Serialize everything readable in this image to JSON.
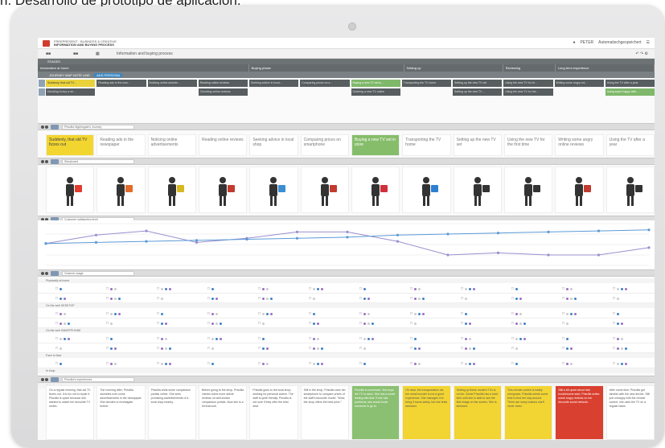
{
  "caption": "n. Desarrollo de prototipo de aplicación.",
  "app": {
    "brand_small": "FREEPRESENT · BUSINESS & CREATIVE",
    "title": "INFORMATION AND BUYING PROCESS",
    "subtitle": "Information and buying process",
    "user": "PETER",
    "project": "Automatischgespeichert"
  },
  "stages_label": "STAGES",
  "phases": [
    "Information at home",
    "Buying phase",
    "Setting up",
    "Reviewing",
    "Long term experience"
  ],
  "persona_label": "JOURNEY MAP NOTE LINE",
  "persona_badge": "ADD PERSONA",
  "steps_row1": [
    {
      "t": "Suddenly, that old TV...",
      "c": "y"
    },
    {
      "t": "Reading ads in the new...",
      "c": ""
    },
    {
      "t": "Noticing online adverts...",
      "c": ""
    },
    {
      "t": "Reading online reviews",
      "c": ""
    },
    {
      "t": "Seeking advice in local...",
      "c": ""
    },
    {
      "t": "Comparing prices on s...",
      "c": ""
    },
    {
      "t": "Buying a new TV set in...",
      "c": "g"
    },
    {
      "t": "Transporting the TV home",
      "c": ""
    },
    {
      "t": "Setting up the new TV set",
      "c": ""
    },
    {
      "t": "Using the new TV for th...",
      "c": ""
    },
    {
      "t": "Writing some angry onl...",
      "c": ""
    },
    {
      "t": "Using the TV after a year",
      "c": ""
    }
  ],
  "steps_row2": [
    {
      "t": "Deciding to buy a ne...",
      "c": ""
    },
    {
      "t": "",
      "c": "e"
    },
    {
      "t": "",
      "c": "e"
    },
    {
      "t": "Checking online reviews",
      "c": ""
    },
    {
      "t": "",
      "c": "e"
    },
    {
      "t": "",
      "c": "e"
    },
    {
      "t": "Ordering a new TV online",
      "c": ""
    },
    {
      "t": "",
      "c": "e"
    },
    {
      "t": "Setting up the new TV ...",
      "c": ""
    },
    {
      "t": "Using the new TV for the...",
      "c": ""
    },
    {
      "t": "",
      "c": "e"
    },
    {
      "t": "Using super happy with...",
      "c": "g"
    }
  ],
  "journey_section": "Priscilla Nightingale's Journey",
  "journey": [
    {
      "t": "Suddenly, that old TV fizzes out",
      "c": "y"
    },
    {
      "t": "Reading ads in the newspaper",
      "c": ""
    },
    {
      "t": "Noticing online advertisements",
      "c": ""
    },
    {
      "t": "Reading online reviews",
      "c": ""
    },
    {
      "t": "Seeking advice in local shop",
      "c": ""
    },
    {
      "t": "Comparing prices on smartphone",
      "c": ""
    },
    {
      "t": "Buying a new TV set in store",
      "c": "g"
    },
    {
      "t": "Transporting the TV home",
      "c": ""
    },
    {
      "t": "Setting up the new TV set",
      "c": ""
    },
    {
      "t": "Using the new TV for the first time",
      "c": ""
    },
    {
      "t": "Writing some angry online reviews",
      "c": ""
    },
    {
      "t": "Using the TV after a year",
      "c": ""
    }
  ],
  "storyboard_section": "Storyboard",
  "storyboard_props": [
    "#e23b2f",
    "#e06b2a",
    "#d8b820",
    "#c23b2f",
    "#3b8fd0",
    "#c23b2f",
    "#d0303a",
    "#2d7fd2",
    "#333333",
    "#333333",
    "#c23b2f",
    "#333333"
  ],
  "satisfaction_section": "Customer satisfaction level",
  "chart_data": {
    "type": "line",
    "title": "",
    "series": [
      {
        "values": [
          3.1,
          3.9,
          4.3,
          3.2,
          3.6,
          4.2,
          4.2,
          3.3,
          2.0,
          2.2,
          2.0,
          2.0,
          2.7
        ]
      },
      {
        "values": [
          3.1,
          3.2,
          3.3,
          3.4,
          3.5,
          3.6,
          3.7,
          3.9,
          4.0,
          4.1,
          4.2,
          4.3,
          4.4
        ]
      }
    ],
    "ylim": [
      1,
      5
    ],
    "colors": [
      "#9a8fcf",
      "#5b9ad6"
    ]
  },
  "channel_section": "Channel usage",
  "channel_groups": [
    "Physically at home",
    "On the web DESKTOP",
    "On the web SMARTPHONE",
    "Face to face",
    "In shop"
  ],
  "add_channel": "Add channel",
  "experience_section": "Priscilla's experiences",
  "experiences": [
    {
      "t": "On a regular evening, that old TV fizzes out. It is too old to repair it. Priscilla is upset because she wanted to watch her favourite TV series.",
      "c": ""
    },
    {
      "t": "The morning after, Priscilla stumbles over some advertisements in the newspaper. She decides to investigate further.",
      "c": ""
    },
    {
      "t": "Priscilla visits some comparison portals online. She sees promising advertisements of a local shop nearby.",
      "c": ""
    },
    {
      "t": "Before going to the shop, Priscilla checks some more article reviews on well-known comparison portals. Now she is a bit insecure.",
      "c": ""
    },
    {
      "t": "Priscilla goes to the local shop, seeking for personal advice. The staff is quite friendly. Priscilla is not sure if they offer the best deal.",
      "c": ""
    },
    {
      "t": "Still in the shop, Priscilla uses her smartphone to compare prices of the staff's favourite model. \"Wow, the shop offers the best price.\"",
      "c": ""
    },
    {
      "t": "Priscilla is convinced. She buys the TV in store. She has a smart feeling with that. If she has problems, she would know someone to go to.",
      "c": "g"
    },
    {
      "t": "Oh dear, the transportation via her small scooter is not a good experience. She manages it to bring it home safely, but she feels stressed.",
      "c": "y"
    },
    {
      "t": "Setting up these modern TVs is no fun. Some Priscilla has a hard time until she is able to see the first image on the screen. She is stressed.",
      "c": "y"
    },
    {
      "t": "This remote control is totally overgrown. Priscilla needs some time to find her way around. There are many buttons she'll never need.",
      "c": "y"
    },
    {
      "t": "Still a bit upset about that troublesome start, Priscilla writes some angry reviews on her favourite social network.",
      "c": "r"
    },
    {
      "t": "After some time, Priscilla got familiar with the new device. Still just unhappy with the remote control, she uses the TV on a regular basis.",
      "c": ""
    }
  ]
}
